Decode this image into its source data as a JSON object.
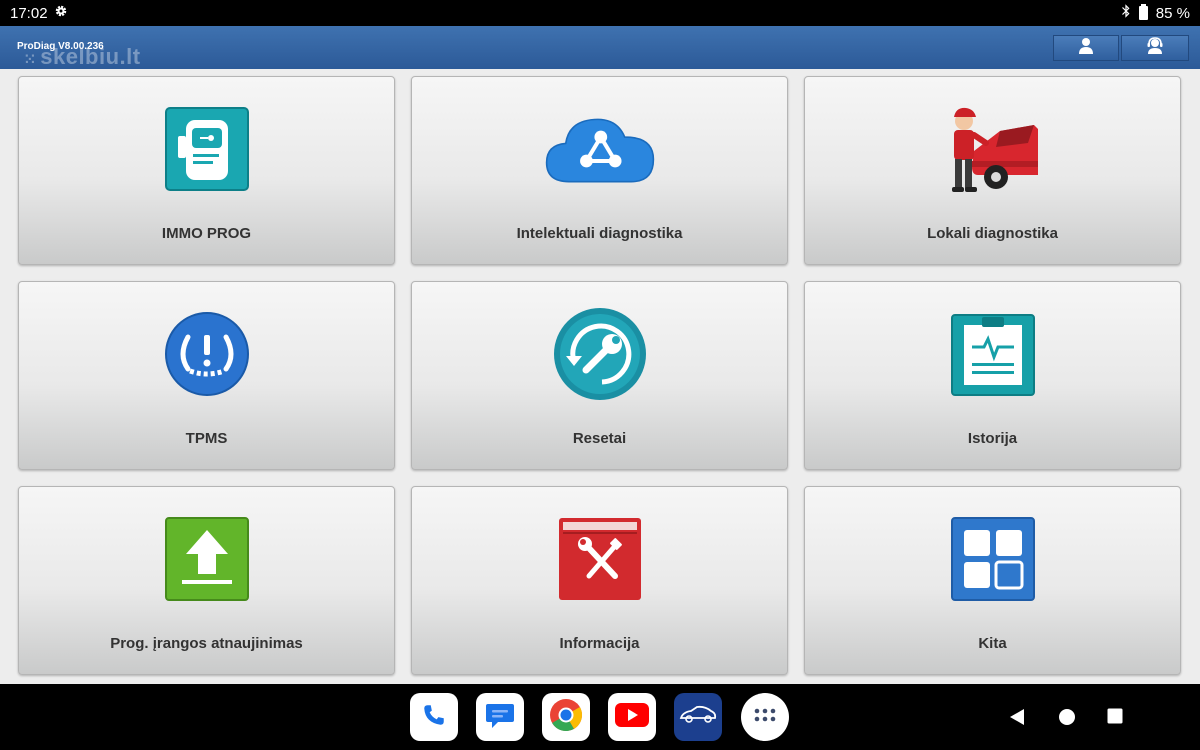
{
  "status_bar": {
    "time": "17:02",
    "battery": "85 %",
    "settings_icon": "gear-icon",
    "bluetooth_icon": "bluetooth-icon",
    "battery_icon": "battery-icon"
  },
  "app_header": {
    "version": "ProDiag V8.00.236",
    "watermark": "skelbiu.lt",
    "buttons": [
      {
        "icon": "user-icon"
      },
      {
        "icon": "support-icon"
      }
    ]
  },
  "tiles": [
    {
      "label": "IMMO PROG",
      "icon": "key-programmer-icon",
      "color": "#19a8b2"
    },
    {
      "label": "Intelektuali diagnostika",
      "icon": "cloud-network-icon",
      "color": "#2a86de"
    },
    {
      "label": "Lokali diagnostika",
      "icon": "mechanic-car-icon",
      "color": "#d8262e"
    },
    {
      "label": "TPMS",
      "icon": "tire-pressure-icon",
      "color": "#2a73cf"
    },
    {
      "label": "Resetai",
      "icon": "reset-wrench-icon",
      "color": "#1f9fb1"
    },
    {
      "label": "Istorija",
      "icon": "history-clipboard-icon",
      "color": "#16a0a8"
    },
    {
      "label": "Prog. įrangos atnaujinimas",
      "icon": "upload-update-icon",
      "color": "#62b52a"
    },
    {
      "label": "Informacija",
      "icon": "info-book-icon",
      "color": "#d22a2e"
    },
    {
      "label": "Kita",
      "icon": "apps-grid-icon",
      "color": "#2f78cc"
    }
  ],
  "dock": [
    {
      "icon": "phone-icon"
    },
    {
      "icon": "messages-icon"
    },
    {
      "icon": "chrome-icon"
    },
    {
      "icon": "youtube-icon"
    },
    {
      "icon": "car-app-icon"
    },
    {
      "icon": "app-drawer-icon"
    }
  ],
  "nav": [
    {
      "icon": "back-icon"
    },
    {
      "icon": "home-icon"
    },
    {
      "icon": "recents-icon"
    }
  ]
}
